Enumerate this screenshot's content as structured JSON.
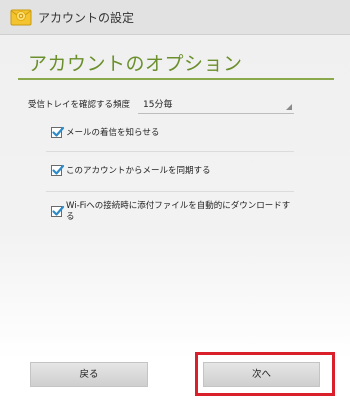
{
  "window": {
    "title": "アカウントの設定",
    "icon": "envelope-icon"
  },
  "section": {
    "title": "アカウントのオプション"
  },
  "inbox_check_frequency": {
    "label": "受信トレイを確認する頻度",
    "selected": "15分毎"
  },
  "options": [
    {
      "label": "メールの着信を知らせる",
      "checked": true
    },
    {
      "label": "このアカウントからメールを同期する",
      "checked": true
    },
    {
      "label": "Wi-Fiへの接続時に添付ファイルを自動的にダウンロードする",
      "checked": true
    }
  ],
  "buttons": {
    "back_label": "戻る",
    "next_label": "次へ"
  },
  "colors": {
    "accent": "#6b8f2c",
    "checkmark": "#2e8bc9",
    "highlight": "#d9202a"
  }
}
